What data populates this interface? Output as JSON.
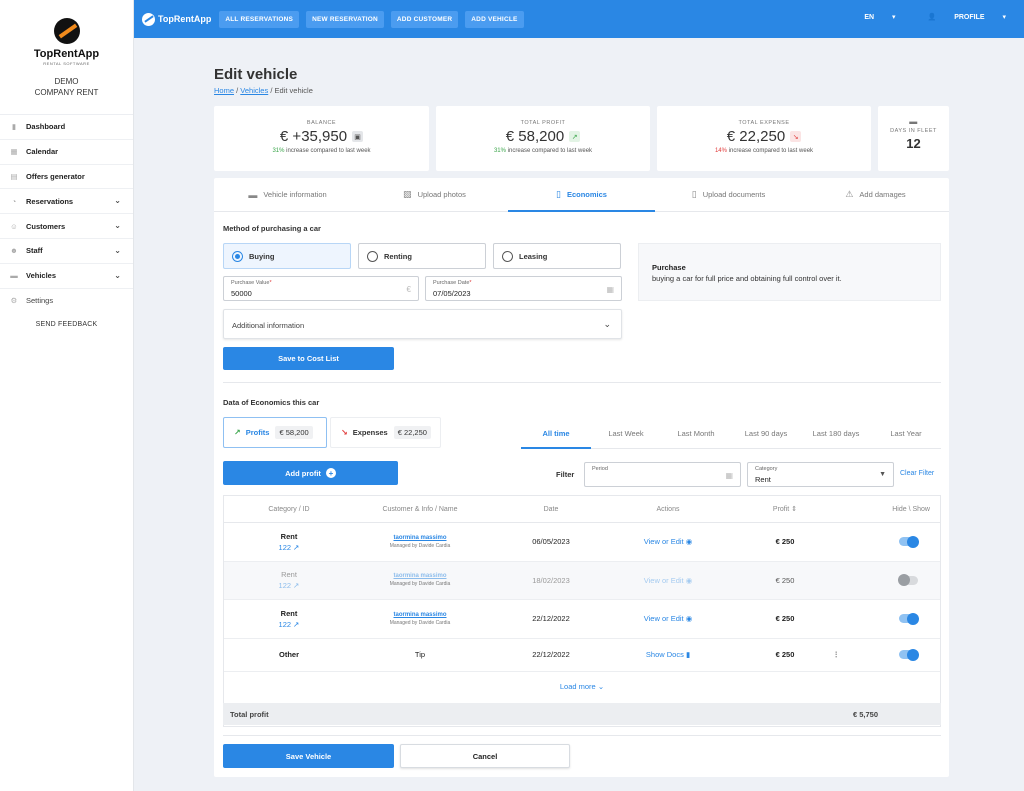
{
  "sidebar": {
    "logo_name": "TopRentApp",
    "logo_sub": "RENTAL SOFTWARE",
    "company_line1": "DEMO",
    "company_line2": "COMPANY RENT",
    "items": [
      {
        "label": "Dashboard",
        "icon": "chart-icon",
        "chevron": false
      },
      {
        "label": "Calendar",
        "icon": "calendar-icon",
        "chevron": false
      },
      {
        "label": "Offers generator",
        "icon": "offer-icon",
        "chevron": false
      },
      {
        "label": "Reservations",
        "icon": "reservations-icon",
        "chevron": true
      },
      {
        "label": "Customers",
        "icon": "customers-icon",
        "chevron": true
      },
      {
        "label": "Staff",
        "icon": "staff-icon",
        "chevron": true
      },
      {
        "label": "Vehicles",
        "icon": "car-icon",
        "chevron": true
      },
      {
        "label": "Settings",
        "icon": "gear-icon",
        "chevron": false
      }
    ],
    "feedback": "SEND FEEDBACK"
  },
  "topbar": {
    "logo": "TopRentApp",
    "buttons": [
      "ALL RESERVATIONS",
      "NEW RESERVATION",
      "ADD CUSTOMER",
      "ADD VEHICLE"
    ],
    "lang": "EN",
    "profile": "PROFILE"
  },
  "page": {
    "title": "Edit vehicle",
    "breadcrumb": {
      "home": "Home",
      "sep": "/",
      "vehicles": "Vehicles",
      "current": "Edit vehicle"
    }
  },
  "stats": {
    "balance": {
      "label": "BALANCE",
      "value": "€ +35,950",
      "pct": "31%",
      "sub": " increase compared to last week"
    },
    "profit": {
      "label": "TOTAL PROFIT",
      "value": "€ 58,200",
      "pct": "31%",
      "sub": " increase compared to last week"
    },
    "expense": {
      "label": "TOTAL EXPENSE",
      "value": "€ 22,250",
      "pct": "14%",
      "sub": " increase compared to last week"
    },
    "days": {
      "label": "DAYS IN FLEET",
      "value": "12"
    }
  },
  "tabs": [
    "Vehicle information",
    "Upload photos",
    "Economics",
    "Upload documents",
    "Add damages"
  ],
  "purchase": {
    "section_title": "Method of purchasing a car",
    "options": [
      "Buying",
      "Renting",
      "Leasing"
    ],
    "value_label": "Purchase Value",
    "value": "50000",
    "currency": "€",
    "date_label": "Purchase Date",
    "date": "07/05/2023",
    "additional": "Additional information",
    "save_btn": "Save to Cost List",
    "info_title": "Purchase",
    "info_desc": "buying a car for full price and obtaining full control over it."
  },
  "economics": {
    "section_title": "Data of Economics this car",
    "profits_label": "Profits",
    "profits_amount": "€ 58,200",
    "expenses_label": "Expenses",
    "expenses_amount": "€ 22,250",
    "time_tabs": [
      "All time",
      "Last Week",
      "Last Month",
      "Last 90 days",
      "Last 180 days",
      "Last Year"
    ],
    "add_profit": "Add profit",
    "filter": "Filter",
    "period_label": "Period",
    "category_label": "Category",
    "category_value": "Rent",
    "clear_filter": "Clear Filter"
  },
  "table": {
    "headers": [
      "Category / ID",
      "Customer & Info / Name",
      "Date",
      "Actions",
      "Profit",
      "Hide \\ Show"
    ],
    "rows": [
      {
        "category": "Rent",
        "id": "122",
        "customer": "taormina massimo",
        "managed": "Managed by Davide Cardia",
        "date": "06/05/2023",
        "action": "View or Edit",
        "profit": "€ 250"
      },
      {
        "category": "Rent",
        "id": "122",
        "customer": "taormina massimo",
        "managed": "Managed by Davide Cardia",
        "date": "18/02/2023",
        "action": "View or Edit",
        "profit": "€ 250"
      },
      {
        "category": "Rent",
        "id": "122",
        "customer": "taormina massimo",
        "managed": "Managed by Davide Cardia",
        "date": "22/12/2022",
        "action": "View or Edit",
        "profit": "€ 250"
      },
      {
        "category": "Other",
        "info": "Tip",
        "date": "22/12/2022",
        "action": "Show Docs",
        "profit": "€ 250"
      }
    ],
    "load_more": "Load more",
    "total_label": "Total profit",
    "total_value": "€ 5,750"
  },
  "footer": {
    "save": "Save Vehicle",
    "cancel": "Cancel"
  },
  "colors": {
    "accent": "#2a87e4",
    "positive": "#3aa54a",
    "negative": "#e03a3a"
  }
}
